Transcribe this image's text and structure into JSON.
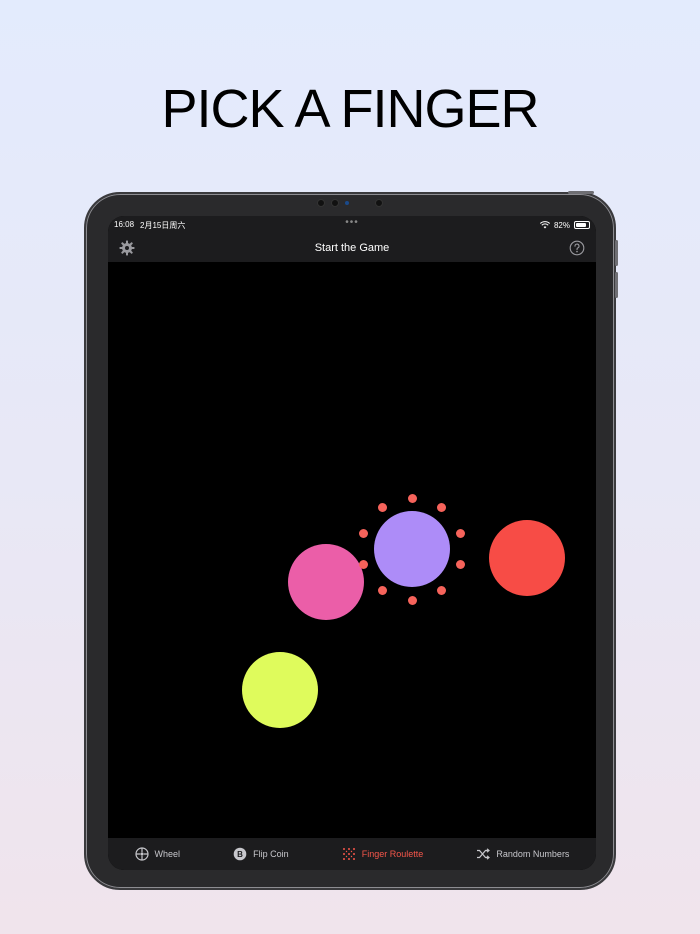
{
  "headline": "PICK A FINGER",
  "status_bar": {
    "time": "16:08",
    "date": "2月15日周六",
    "dots": "•••",
    "battery": "82%"
  },
  "nav": {
    "title": "Start the Game",
    "settings_icon": "gear-icon",
    "help_icon": "help-icon"
  },
  "touch_points": [
    {
      "name": "touch-point-pink",
      "color": "#eb5ea8"
    },
    {
      "name": "touch-point-purple-selected",
      "color": "#ad8cf8",
      "selected": true
    },
    {
      "name": "touch-point-red",
      "color": "#f74c46"
    },
    {
      "name": "touch-point-yellow",
      "color": "#dffb5c"
    }
  ],
  "selection_dot_color": "#f6635b",
  "tabs": [
    {
      "label": "Wheel",
      "icon": "wheel-icon",
      "active": false
    },
    {
      "label": "Flip Coin",
      "icon": "coin-icon",
      "active": false
    },
    {
      "label": "Finger Roulette",
      "icon": "finger-roulette-icon",
      "active": true
    },
    {
      "label": "Random Numbers",
      "icon": "shuffle-icon",
      "active": false
    }
  ],
  "colors": {
    "accent": "#f5564a",
    "bar_background": "#1c1c1e"
  }
}
